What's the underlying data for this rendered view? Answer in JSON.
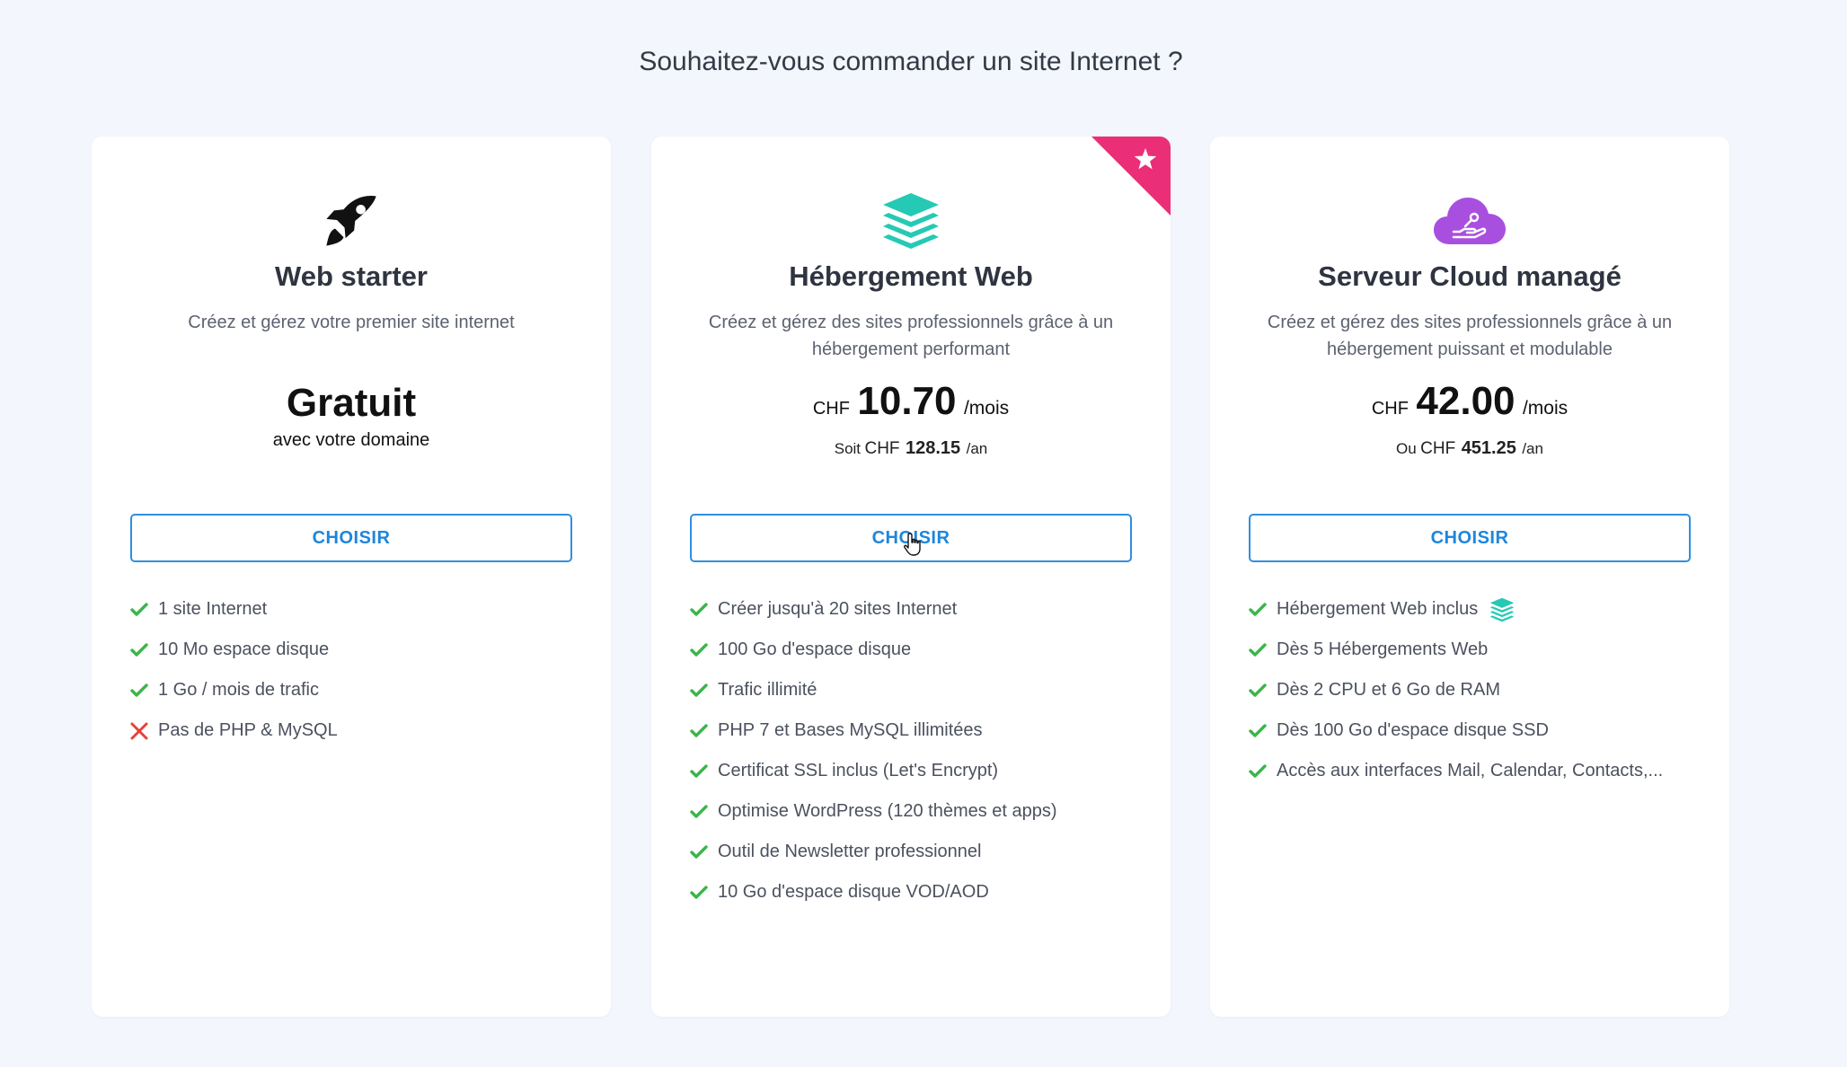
{
  "page": {
    "title": "Souhaitez-vous commander un site Internet ?"
  },
  "colors": {
    "accent": "#1e86dc",
    "check": "#3bb54a",
    "cross": "#e5413a",
    "ribbon": "#ea2f78",
    "stack_icon": "#25c9b4",
    "cloud_icon": "#a94fe0"
  },
  "plans": [
    {
      "icon": "rocket-icon",
      "name": "Web starter",
      "description": "Créez et gérez votre premier site internet",
      "price_label": "Gratuit",
      "price_sub": "avec votre domaine",
      "button": "CHOISIR",
      "features": [
        {
          "text": "1 site Internet",
          "included": true
        },
        {
          "text": "10 Mo espace disque",
          "included": true
        },
        {
          "text": "1 Go / mois de trafic",
          "included": true
        },
        {
          "text": "Pas de PHP & MySQL",
          "included": false
        }
      ]
    },
    {
      "icon": "stack-layers-icon",
      "badge_icon": "star-icon",
      "name": "Hébergement Web",
      "description": "Créez et gérez des sites professionnels grâce à un hébergement performant",
      "currency": "CHF",
      "price": "10.70",
      "period": "/mois",
      "yearly_prefix": "Soit",
      "yearly_currency": "CHF",
      "yearly_price": "128.15",
      "yearly_period": "/an",
      "button": "CHOISIR",
      "features": [
        {
          "text": "Créer jusqu'à 20 sites Internet",
          "included": true
        },
        {
          "text": "100 Go d'espace disque",
          "included": true
        },
        {
          "text": "Trafic illimité",
          "included": true
        },
        {
          "text": "PHP 7 et Bases MySQL illimitées",
          "included": true
        },
        {
          "text": "Certificat SSL inclus (Let's Encrypt)",
          "included": true
        },
        {
          "text": "Optimise WordPress (120 thèmes et apps)",
          "included": true
        },
        {
          "text": "Outil de Newsletter professionnel",
          "included": true
        },
        {
          "text": "10 Go d'espace disque VOD/AOD",
          "included": true
        }
      ]
    },
    {
      "icon": "cloud-hand-icon",
      "name": "Serveur Cloud managé",
      "description": "Créez et gérez des sites professionnels grâce à un hébergement puissant et modulable",
      "currency": "CHF",
      "price": "42.00",
      "period": "/mois",
      "yearly_prefix": "Ou",
      "yearly_currency": "CHF",
      "yearly_price": "451.25",
      "yearly_period": "/an",
      "button": "CHOISIR",
      "features": [
        {
          "text": "Hébergement Web inclus",
          "included": true
        },
        {
          "text": "Dès 5 Hébergements Web",
          "included": true
        },
        {
          "text": "Dès 2 CPU et 6 Go de RAM",
          "included": true
        },
        {
          "text": "Dès 100 Go d'espace disque SSD",
          "included": true
        },
        {
          "text": "Accès aux interfaces Mail, Calendar, Contacts,...",
          "included": true
        }
      ]
    }
  ]
}
